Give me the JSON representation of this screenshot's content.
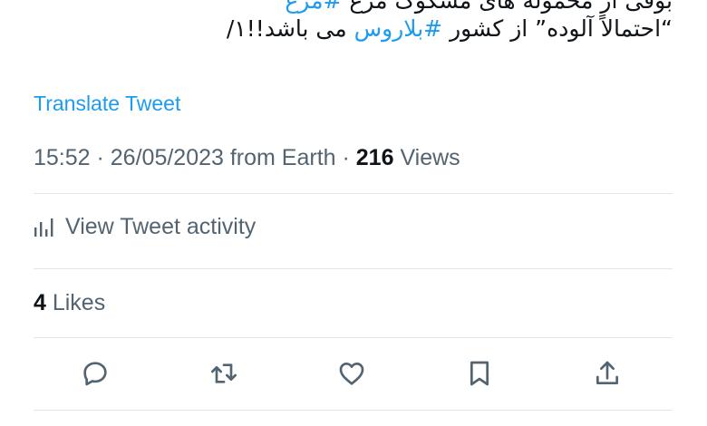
{
  "tweet": {
    "text_top_partial": "بوقی از محموله های مشکوک مرغ",
    "text_top_hashtag": "#مرغ",
    "text_prefix": "“احتمالاً آلوده” از کشور",
    "hashtag": "#بلاروس",
    "text_suffix": "می باشد!!١/"
  },
  "translate_label": "Translate Tweet",
  "meta": {
    "time": "15:52",
    "sep1": " · ",
    "date": "26/05/2023",
    "source": " from Earth",
    "sep2": " · ",
    "views_count": "216",
    "views_label": " Views"
  },
  "activity": {
    "label": "View Tweet activity",
    "icon": "analytics-icon"
  },
  "likes": {
    "count": "4",
    "label": " Likes"
  },
  "actions": {
    "reply": "reply-icon",
    "retweet": "retweet-icon",
    "like": "heart-icon",
    "bookmark": "bookmark-icon",
    "share": "share-icon"
  },
  "colors": {
    "link": "#1d9bf0",
    "text_primary": "#0f1419",
    "text_secondary": "#536471",
    "divider": "#e1e6ea"
  }
}
